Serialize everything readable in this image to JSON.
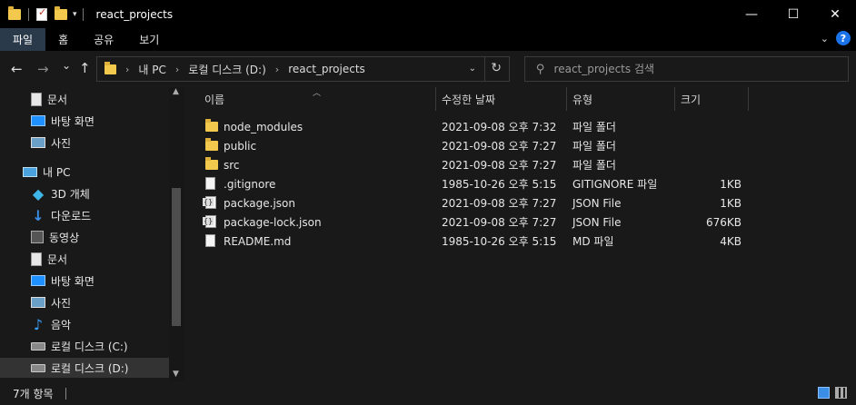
{
  "window": {
    "title": "react_projects"
  },
  "window_controls": {
    "minimize": "—",
    "maximize": "☐",
    "close": "✕"
  },
  "ribbon": {
    "tabs": [
      "파일",
      "홈",
      "공유",
      "보기"
    ],
    "expand_icon": "chevron-down",
    "help": "?"
  },
  "nav": {
    "back": "←",
    "forward": "→",
    "recent": "⌄",
    "up": "↑"
  },
  "address": {
    "crumbs": [
      "내 PC",
      "로컬 디스크 (D:)",
      "react_projects"
    ],
    "separator": "›"
  },
  "search": {
    "placeholder": "react_projects 검색"
  },
  "sidebar": {
    "items": [
      {
        "label": "문서",
        "icon": "documents-icon"
      },
      {
        "label": "바탕 화면",
        "icon": "desktop-icon"
      },
      {
        "label": "사진",
        "icon": "pictures-icon"
      },
      {
        "label": "내 PC",
        "icon": "this-pc-icon"
      },
      {
        "label": "3D 개체",
        "icon": "3d-objects-icon"
      },
      {
        "label": "다운로드",
        "icon": "downloads-icon"
      },
      {
        "label": "동영상",
        "icon": "videos-icon"
      },
      {
        "label": "문서",
        "icon": "documents-icon"
      },
      {
        "label": "바탕 화면",
        "icon": "desktop-icon"
      },
      {
        "label": "사진",
        "icon": "pictures-icon"
      },
      {
        "label": "음악",
        "icon": "music-icon"
      },
      {
        "label": "로컬 디스크 (C:)",
        "icon": "drive-icon"
      },
      {
        "label": "로컬 디스크 (D:)",
        "icon": "drive-icon",
        "selected": true
      }
    ]
  },
  "columns": {
    "name": "이름",
    "date": "수정한 날짜",
    "type": "유형",
    "size": "크기"
  },
  "files": [
    {
      "name": "node_modules",
      "date": "2021-09-08 오후 7:32",
      "type": "파일 폴더",
      "size": "",
      "kind": "folder"
    },
    {
      "name": "public",
      "date": "2021-09-08 오후 7:27",
      "type": "파일 폴더",
      "size": "",
      "kind": "folder"
    },
    {
      "name": "src",
      "date": "2021-09-08 오후 7:27",
      "type": "파일 폴더",
      "size": "",
      "kind": "folder"
    },
    {
      "name": ".gitignore",
      "date": "1985-10-26 오후 5:15",
      "type": "GITIGNORE 파일",
      "size": "1KB",
      "kind": "file"
    },
    {
      "name": "package.json",
      "date": "2021-09-08 오후 7:27",
      "type": "JSON File",
      "size": "1KB",
      "kind": "json"
    },
    {
      "name": "package-lock.json",
      "date": "2021-09-08 오후 7:27",
      "type": "JSON File",
      "size": "676KB",
      "kind": "json"
    },
    {
      "name": "README.md",
      "date": "1985-10-26 오후 5:15",
      "type": "MD 파일",
      "size": "4KB",
      "kind": "file"
    }
  ],
  "status": {
    "count": "7개 항목"
  }
}
